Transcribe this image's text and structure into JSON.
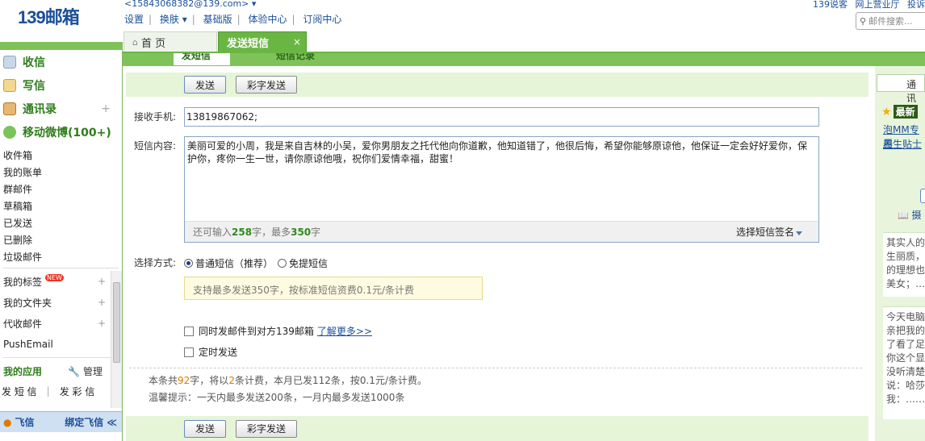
{
  "header": {
    "logo": "139邮箱",
    "user_email": "<15843068382@139.com> ▾",
    "links": [
      "设置",
      "换肤 ▾",
      "基础版",
      "体验中心",
      "订阅中心"
    ],
    "right_links": [
      "139说客",
      "网上营业厅",
      "投诉"
    ],
    "search_placeholder": "邮件搜索..."
  },
  "tabs": [
    {
      "label": "首 页",
      "icon": "home-icon"
    },
    {
      "label": "发送短信",
      "active": true,
      "close": "×"
    }
  ],
  "sidebar": {
    "main_items": [
      {
        "label": "收信",
        "icon": "inbox-icon"
      },
      {
        "label": "写信",
        "icon": "compose-icon"
      },
      {
        "label": "通讯录",
        "icon": "contacts-icon",
        "plus": "+"
      },
      {
        "label": "移动微博(100+)",
        "icon": "weibo-icon"
      }
    ],
    "folders": [
      "收件箱",
      "我的账单",
      "群邮件",
      "草稿箱",
      "已发送",
      "已删除",
      "垃圾邮件"
    ],
    "sections": [
      {
        "label": "我的标签",
        "badge": "NEW",
        "plus": "+"
      },
      {
        "label": "我的文件夹",
        "plus": "+"
      },
      {
        "label": "代收邮件",
        "plus": "+"
      },
      {
        "label": "PushEmail"
      }
    ],
    "apps_title": "我的应用",
    "apps_manage": "管理",
    "apps_row": [
      "发 短 信",
      "|",
      "发 彩 信"
    ],
    "fetion_label": "飞信",
    "fetion_bind": "绑定飞信 ≪"
  },
  "compose": {
    "subtabs": [
      "发短信",
      "短信记录"
    ],
    "send_label": "发送",
    "color_send_label": "彩字发送",
    "phone_label": "接收手机:",
    "phone_value": "13819867062;",
    "content_label": "短信内容:",
    "content_value": "美丽可爱的小周，我是来自吉林的小吴，爱你男朋友之托代他向你道歉，他知道错了，他很后悔，希望你能够原谅他，他保证一定会好好爱你，保护你，疼你一生一世，请你原谅他哦，祝你们爱情幸福，甜蜜！",
    "remaining_prefix": "还可输入",
    "remaining_count": "258",
    "remaining_mid": "字，最多",
    "max_count": "350",
    "remaining_suffix": "字",
    "signature_label": "选择短信签名",
    "mode_label": "选择方式:",
    "mode_options": [
      "普通短信（推荐）",
      "免提短信"
    ],
    "mode_selected": 0,
    "mode_tip": "支持最多发送350字，按标准短信资费0.1元/条计费",
    "check_mail": "同时发邮件到对方139邮箱",
    "learn_more": "了解更多>>",
    "check_timed": "定时发送",
    "info_prefix": "本条共",
    "info_chars": "92",
    "info_mid1": "字，将以",
    "info_count": "2",
    "info_mid2": "条计费，本月已发112条，按0.1元/条计费。",
    "info2": "温馨提示：一天内最多发送200条，一月内最多发送1000条"
  },
  "right_panel": {
    "input_text": "通讯",
    "news_label": "最新",
    "links": [
      "泡MM专用",
      "养生贴士"
    ],
    "book_text": "摄",
    "card1": [
      "其实人的",
      "生丽质，",
      "的理想也",
      "美女；…"
    ],
    "card2": [
      "今天电脑",
      "亲把我的",
      "了看了足",
      "你这个显",
      "没听清楚",
      "说：哈莎",
      "我：……"
    ]
  }
}
